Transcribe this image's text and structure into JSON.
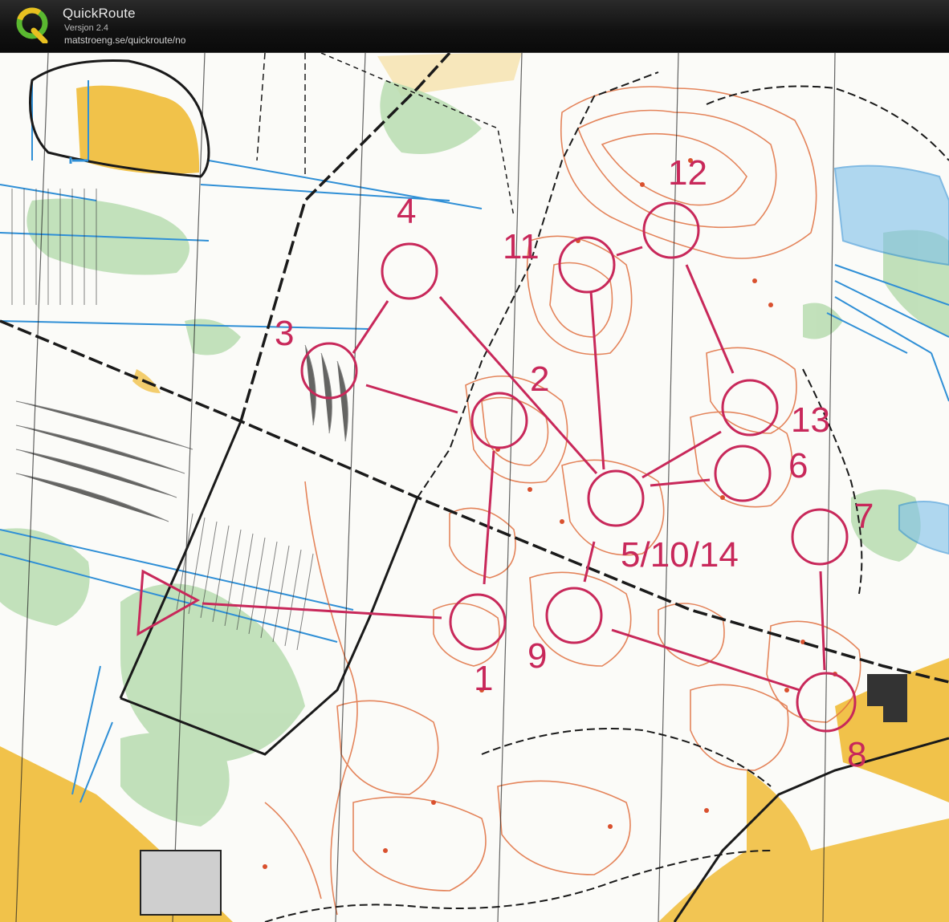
{
  "app": {
    "title": "QuickRoute",
    "version": "Versjon 2.4",
    "url": "matstroeng.se/quickroute/no",
    "logo_letter": "Q",
    "logo_icon": "quickroute-logo-icon"
  },
  "colors": {
    "course": "#c8285a",
    "contour": "#e07040",
    "open_land": "#f1c24a",
    "vegetation": "#b7dcb0",
    "water": "#2f8fd6",
    "track": "#1a1a1a",
    "paper": "#fbfbf8"
  },
  "course": {
    "start_icon": "start-triangle-icon",
    "controls": [
      {
        "label": "1"
      },
      {
        "label": "2"
      },
      {
        "label": "3"
      },
      {
        "label": "4"
      },
      {
        "label": "5/10/14"
      },
      {
        "label": "6"
      },
      {
        "label": "7"
      },
      {
        "label": "8"
      },
      {
        "label": "9"
      },
      {
        "label": "11"
      },
      {
        "label": "12"
      },
      {
        "label": "13"
      }
    ]
  }
}
